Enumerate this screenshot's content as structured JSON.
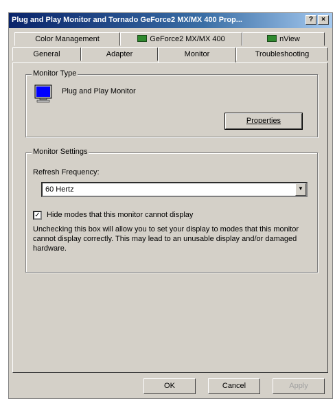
{
  "window": {
    "title": "Plug and Play Monitor and Tornado GeForce2 MX/MX 400 Prop...",
    "help_label": "?",
    "close_label": "×"
  },
  "tabs": {
    "row1": [
      {
        "label": "Color Management",
        "icon": "none"
      },
      {
        "label": "GeForce2 MX/MX 400",
        "icon": "nvidia-icon"
      },
      {
        "label": "nView",
        "icon": "nvidia-icon"
      }
    ],
    "row2": [
      {
        "label": "General"
      },
      {
        "label": "Adapter"
      },
      {
        "label": "Monitor",
        "active": true
      },
      {
        "label": "Troubleshooting"
      }
    ]
  },
  "monitor_type": {
    "group_label": "Monitor Type",
    "name": "Plug and Play Monitor",
    "properties_button": "Properties"
  },
  "monitor_settings": {
    "group_label": "Monitor Settings",
    "refresh_label": "Refresh Frequency:",
    "refresh_value": "60 Hertz",
    "hide_modes_label": "Hide modes that this monitor cannot display",
    "hide_modes_checked": true,
    "checkmark": "✓",
    "dropdown_arrow": "▼",
    "description": "Unchecking this box will allow you to set your display to modes that this monitor cannot display correctly. This may lead to an unusable display and/or damaged hardware."
  },
  "buttons": {
    "ok": "OK",
    "cancel": "Cancel",
    "apply": "Apply"
  }
}
